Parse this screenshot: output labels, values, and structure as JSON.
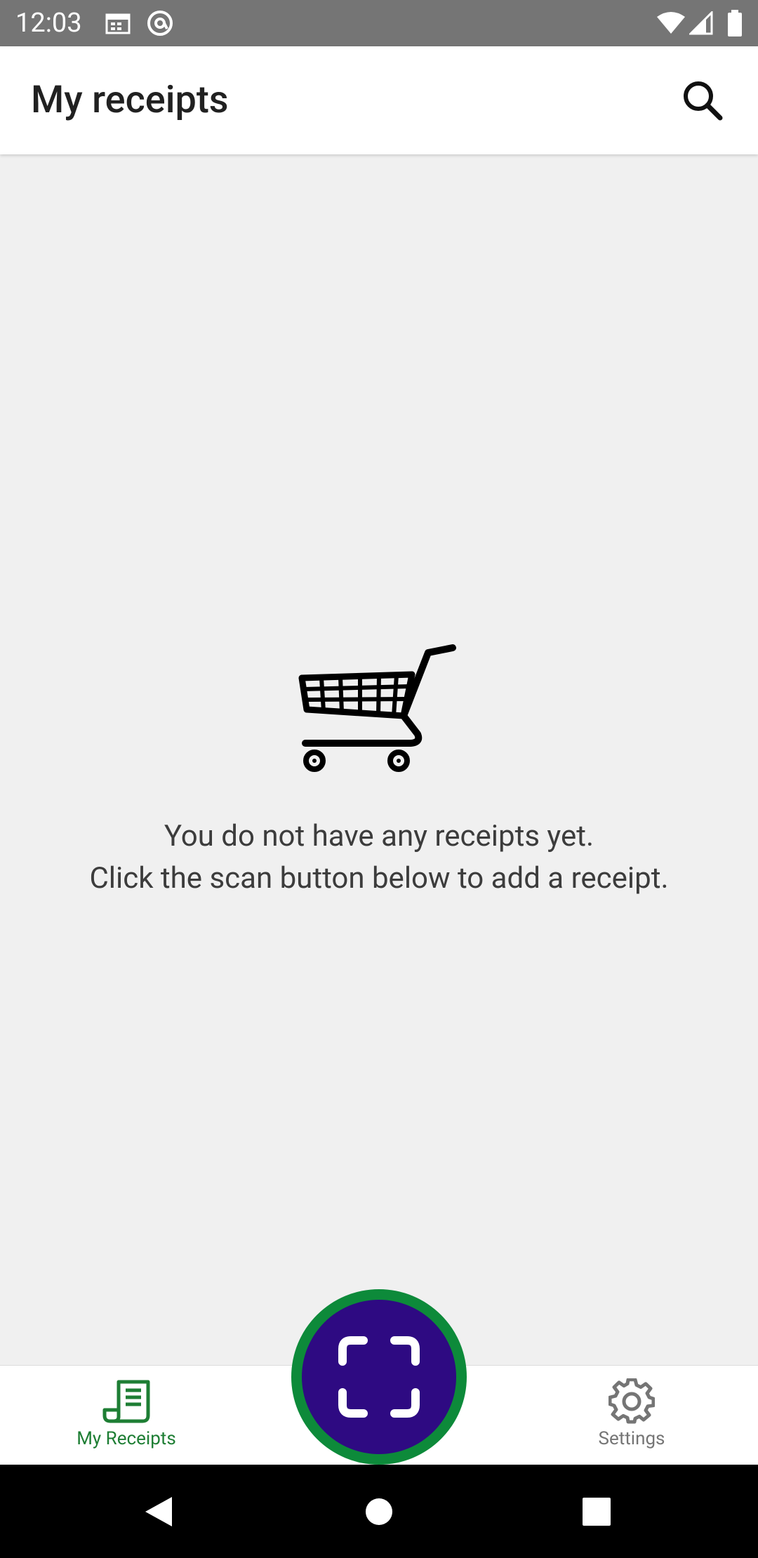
{
  "status_bar": {
    "time": "12:03",
    "icons": [
      "calendar-icon",
      "at-sign-icon",
      "wifi-icon",
      "signal-icon",
      "battery-icon"
    ]
  },
  "app_bar": {
    "title": "My receipts",
    "search_icon": "search-icon"
  },
  "empty_state": {
    "icon": "shopping-cart-icon",
    "line1": "You do not have any receipts yet.",
    "line2": "Click the scan button below to add a receipt."
  },
  "bottom_nav": {
    "items": [
      {
        "label": "My Receipts",
        "icon": "receipt-icon",
        "selected": true
      },
      {
        "label": "Settings",
        "icon": "gear-icon",
        "selected": false
      }
    ],
    "scan_icon": "scan-icon"
  },
  "system_nav": [
    "back-icon",
    "home-icon",
    "recents-icon"
  ],
  "colors": {
    "accent_green": "#1e7e34",
    "fab_ring": "#0d8a3a",
    "fab_fill": "#2e0a82",
    "status_bar": "#757575",
    "background": "#f0f0f0"
  }
}
